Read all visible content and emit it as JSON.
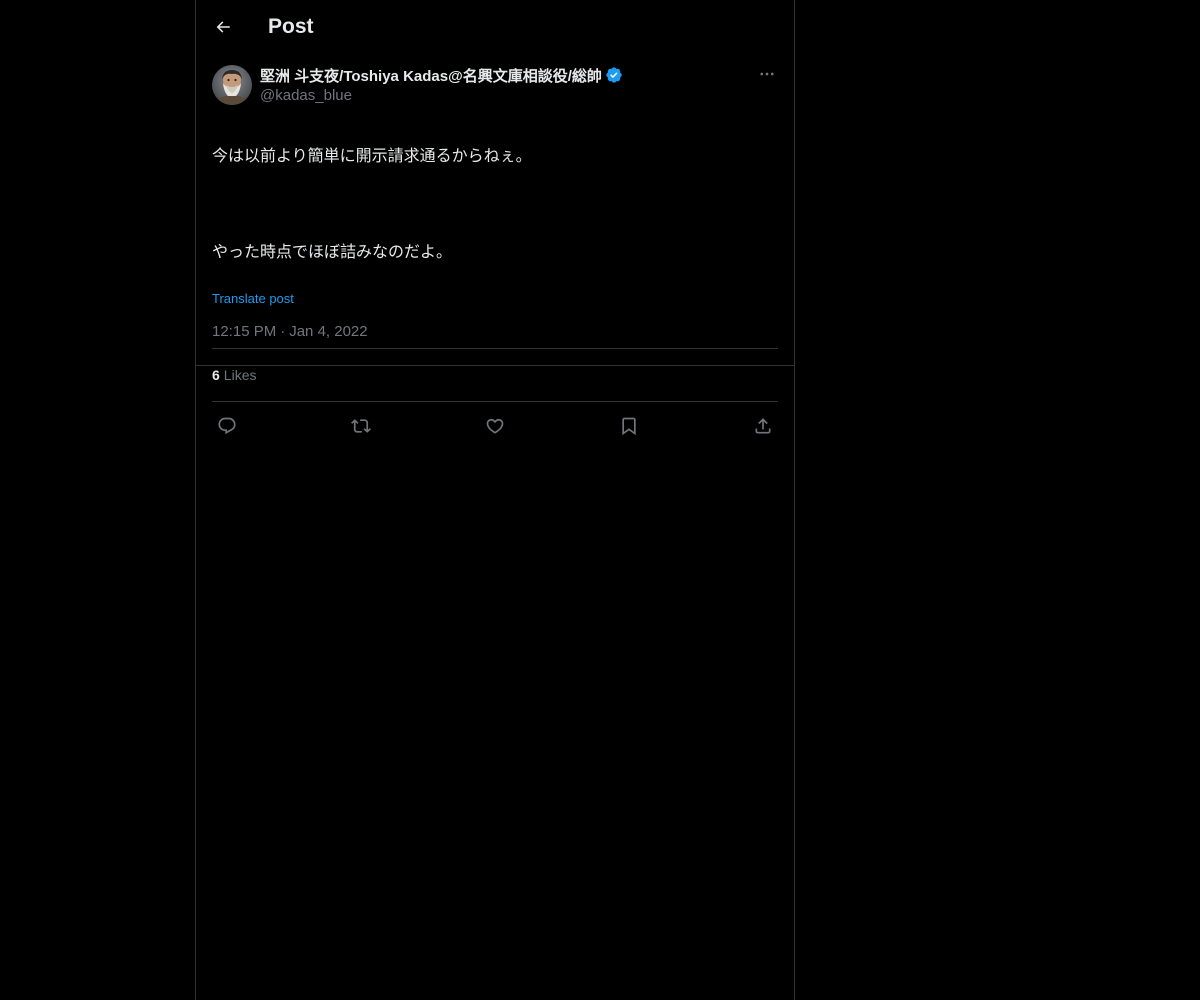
{
  "header": {
    "title": "Post",
    "back_icon": "arrow-left-icon"
  },
  "post": {
    "author": {
      "display_name": "堅洲 斗支夜/Toshiya Kadas@名興文庫相談役/総帥",
      "handle": "@kadas_blue",
      "verified": true,
      "verified_color": "#1d9bf0"
    },
    "text_line_1": "今は以前より簡単に開示請求通るからねぇ。",
    "text_line_2": "やった時点でほぼ詰みなのだよ。",
    "translate_label": "Translate post",
    "time": "12:15 PM",
    "separator": "·",
    "date": "Jan 4, 2022",
    "likes_count": "6",
    "likes_label": "Likes"
  },
  "actions": [
    {
      "name": "reply",
      "icon": "reply-icon"
    },
    {
      "name": "repost",
      "icon": "repost-icon"
    },
    {
      "name": "like",
      "icon": "heart-icon"
    },
    {
      "name": "bookmark",
      "icon": "bookmark-icon"
    },
    {
      "name": "share",
      "icon": "share-icon"
    }
  ],
  "colors": {
    "background": "#000000",
    "text": "#e7e9ea",
    "secondary": "#71767b",
    "accent": "#1d9bf0",
    "border": "#2f3336"
  }
}
